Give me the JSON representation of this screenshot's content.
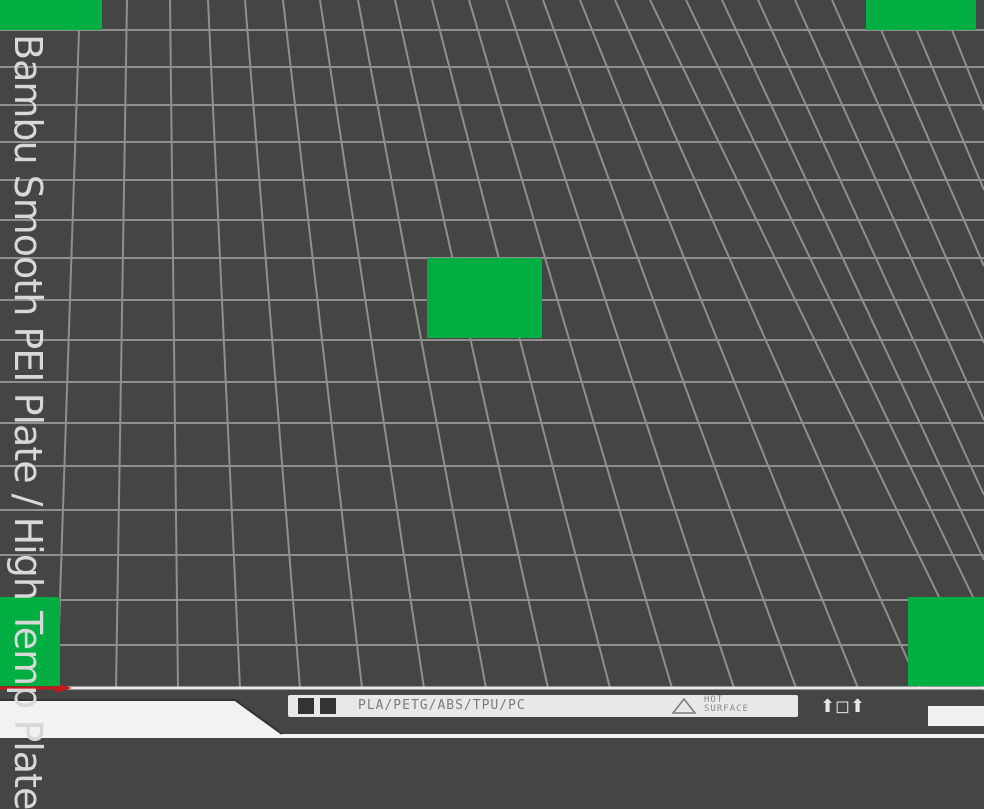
{
  "scene": {
    "plate_label": "Bambu Smooth PEI Plate / High Temp Plate",
    "legend": {
      "materials": "PLA/PETG/ABS/TPU/PC",
      "warning_line1": "HOT",
      "warning_line2": "SURFACE"
    },
    "colors": {
      "bed": "#444545",
      "grid": "#8f8f8f",
      "object": "#00ae42",
      "border": "#e9e9e9",
      "axis_x": "#c61919"
    }
  }
}
